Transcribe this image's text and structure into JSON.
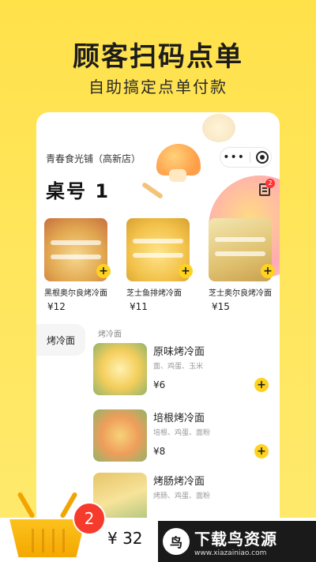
{
  "hero": {
    "title": "顾客扫码点单",
    "subtitle": "自助搞定点单付款"
  },
  "shop": {
    "name": "青春食光铺（高新店）",
    "table_label": "桌号 1",
    "order_badge": "2",
    "menu_dots": "•••"
  },
  "recommended": [
    {
      "name": "黑根奥尔良烤冷面",
      "price": "¥12"
    },
    {
      "name": "芝士鱼排烤冷面",
      "price": "¥11"
    },
    {
      "name": "芝士奥尔良烤冷面",
      "price": "¥15"
    }
  ],
  "categories": [
    {
      "label": "烤冷面",
      "selected": true
    }
  ],
  "menu": {
    "section_title": "烤冷面",
    "items": [
      {
        "name": "原味烤冷面",
        "desc": "面、鸡蛋、玉米",
        "price": "¥6"
      },
      {
        "name": "培根烤冷面",
        "desc": "培根、鸡蛋、面粉",
        "price": "¥8"
      },
      {
        "name": "烤肠烤冷面",
        "desc": "烤肠、鸡蛋、面粉",
        "price": ""
      }
    ]
  },
  "cart": {
    "count": "2",
    "total": "¥ 32"
  },
  "add_symbol": "+",
  "watermark": {
    "logo_char": "鸟",
    "title": "下载鸟资源",
    "url": "www.xiazainiao.com"
  },
  "colors": {
    "background": "#FFE14A",
    "accent": "#FFD21F",
    "badge": "#F63B2C"
  },
  "icons": [
    "more-dots-icon",
    "target-icon",
    "order-list-icon",
    "plus-icon",
    "basket-icon"
  ]
}
